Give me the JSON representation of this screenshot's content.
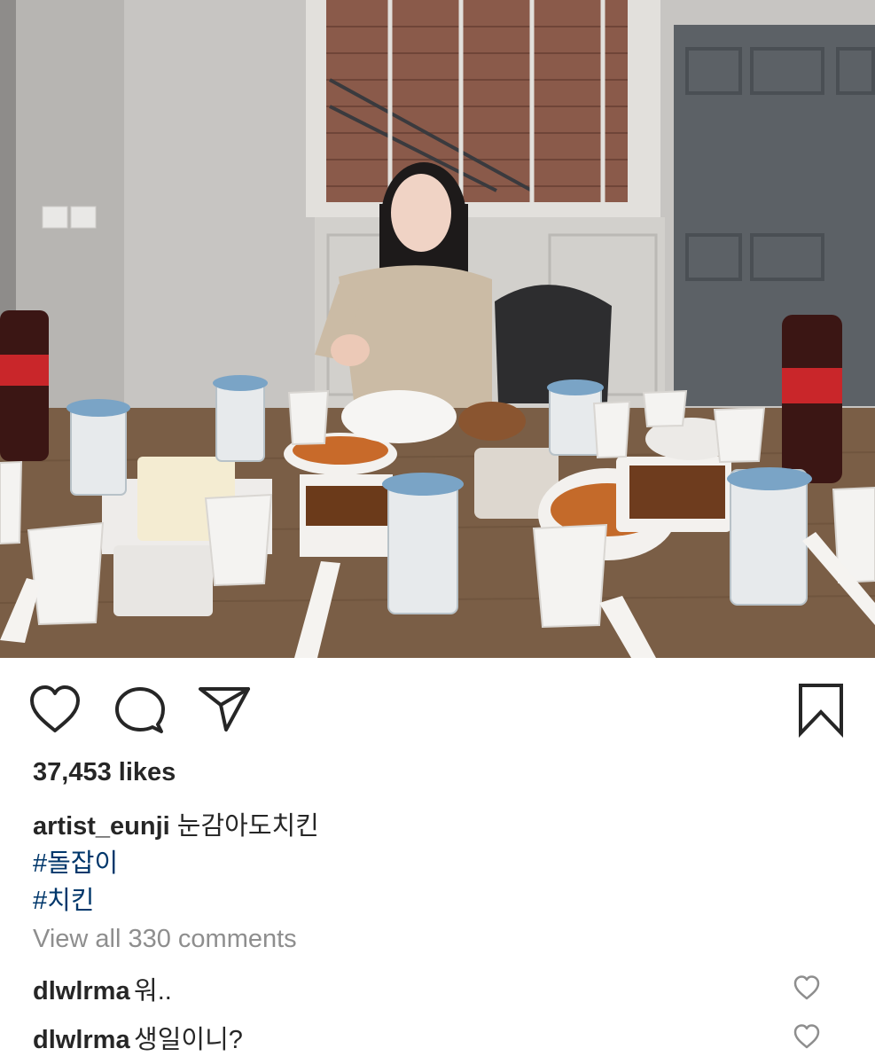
{
  "post": {
    "photo_alt": "Photo post image",
    "likes_text": "37,453 likes",
    "caption": {
      "username": "artist_eunji",
      "text": "눈감아도치킨"
    },
    "hashtags": [
      "#돌잡이",
      "#치킨"
    ],
    "view_all_comments": "View all 330 comments",
    "comments": [
      {
        "username": "dlwlrma",
        "text": "워.."
      },
      {
        "username": "dlwlrma",
        "text": "생일이니?"
      }
    ]
  },
  "icons": {
    "like": "heart-icon",
    "comment": "speech-bubble-icon",
    "share": "paper-plane-icon",
    "save": "bookmark-icon",
    "comment_like": "small-heart-icon"
  },
  "colors": {
    "text": "#262626",
    "hashtag": "#00376b",
    "muted": "#8e8e8e"
  }
}
